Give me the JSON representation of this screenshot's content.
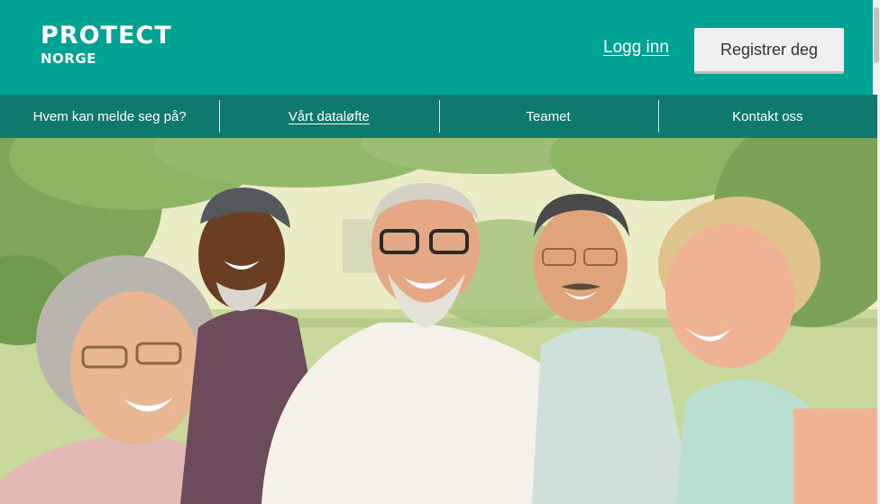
{
  "brand": {
    "name": "PROTECT",
    "subname": "NORGE"
  },
  "header": {
    "login_label": "Logg inn",
    "register_label": "Registrer deg"
  },
  "nav": {
    "items": [
      {
        "label": "Hvem kan melde seg på?"
      },
      {
        "label": "Vårt dataløfte"
      },
      {
        "label": "Teamet"
      },
      {
        "label": "Kontakt oss"
      }
    ]
  },
  "colors": {
    "header_bg": "#00a393",
    "nav_bg": "#0e7a6e",
    "button_bg": "#efefef"
  },
  "hero": {
    "subject": "group-of-smiling-seniors-photo"
  }
}
